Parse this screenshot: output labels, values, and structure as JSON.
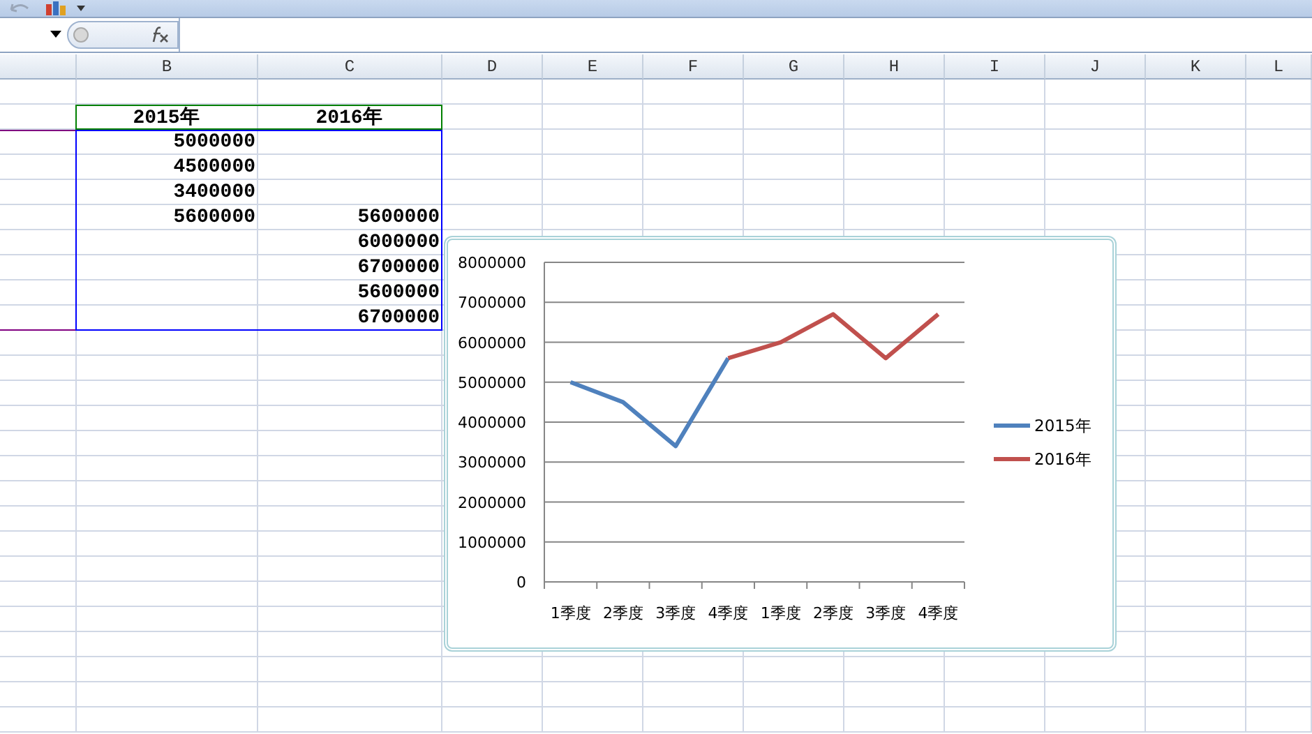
{
  "columns": [
    "B",
    "C",
    "D",
    "E",
    "F",
    "G",
    "H",
    "I",
    "J",
    "K",
    "L"
  ],
  "rows": [
    {
      "kind": "header",
      "b": "2015年",
      "c": "2016年"
    },
    {
      "kind": "value",
      "b": "5000000"
    },
    {
      "kind": "value",
      "b": "4500000"
    },
    {
      "kind": "value",
      "b": "3400000"
    },
    {
      "kind": "value",
      "b": "5600000",
      "c": "5600000"
    },
    {
      "kind": "value",
      "c": "6000000"
    },
    {
      "kind": "value",
      "c": "6700000"
    },
    {
      "kind": "value",
      "c": "5600000"
    },
    {
      "kind": "value",
      "c": "6700000"
    }
  ],
  "chart": {
    "chart_data": {
      "type": "line",
      "grid": true,
      "legend": "right",
      "categories": [
        "1季度",
        "2季度",
        "3季度",
        "4季度",
        "1季度",
        "2季度",
        "3季度",
        "4季度"
      ],
      "series": [
        {
          "name": "2015年",
          "color": "#4f81bd",
          "values": [
            5000000,
            4500000,
            3400000,
            5600000,
            null,
            null,
            null,
            null
          ]
        },
        {
          "name": "2016年",
          "color": "#c0504d",
          "values": [
            null,
            null,
            null,
            5600000,
            6000000,
            6700000,
            5600000,
            6700000
          ]
        }
      ],
      "ylim": [
        0,
        8000000
      ],
      "yticks": [
        0,
        1000000,
        2000000,
        3000000,
        4000000,
        5000000,
        6000000,
        7000000,
        8000000
      ]
    }
  }
}
